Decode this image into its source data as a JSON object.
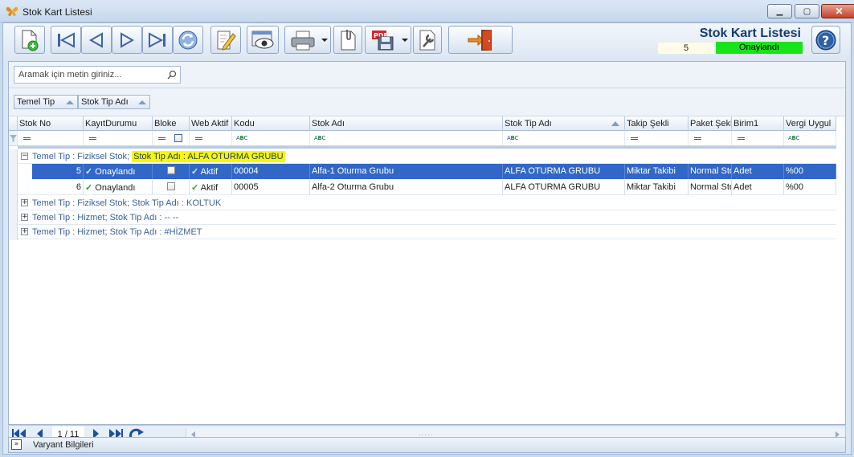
{
  "window": {
    "title": "Stok Kart Listesi"
  },
  "header": {
    "title": "Stok Kart Listesi",
    "count": "5",
    "status": "Onaylandı"
  },
  "search": {
    "placeholder": "Aramak için metin giriniz..."
  },
  "group_by": [
    "Temel Tip",
    "Stok Tip Adı"
  ],
  "columns": [
    "Stok No",
    "KayıtDurumu",
    "Bloke",
    "Web Aktif",
    "Kodu",
    "Stok Adı",
    "Stok Tip Adı",
    "Takip Şekli",
    "Paket Şekli",
    "Birim1",
    "Vergi Uygul"
  ],
  "groups": [
    {
      "expander": "−",
      "label": "Temel Tip : Fiziksel Stok;",
      "label2": "Stok Tip Adı : ALFA OTURMA GRUBU"
    },
    {
      "expander": "+",
      "label": "Temel Tip : Fiziksel Stok;",
      "label2": "Stok Tip Adı : KOLTUK"
    },
    {
      "expander": "+",
      "label": "Temel Tip : Hizmet;",
      "label2": "Stok Tip Adı : -- --"
    },
    {
      "expander": "+",
      "label": "Temel Tip : Hizmet;",
      "label2": "Stok Tip Adı : #HİZMET"
    }
  ],
  "rows": [
    {
      "no": "5",
      "durum": "Onaylandı",
      "web": "Aktif",
      "kodu": "00004",
      "adi": "Alfa-1 Oturma Grubu",
      "tip": "ALFA OTURMA GRUBU",
      "takip": "Miktar Takibi",
      "paket": "Normal Stok",
      "birim": "Adet",
      "vergi": "%00"
    },
    {
      "no": "6",
      "durum": "Onaylandı",
      "web": "Aktif",
      "kodu": "00005",
      "adi": "Alfa-2 Oturma Grubu",
      "tip": "ALFA OTURMA GRUBU",
      "takip": "Miktar Takibi",
      "paket": "Normal Stok",
      "birim": "Adet",
      "vergi": "%00"
    }
  ],
  "pager": {
    "info": "1 / 11"
  },
  "footer": {
    "variant_label": "Varyant Bilgileri"
  },
  "colors": {
    "accent": "#3167c6",
    "status_green": "#19e319",
    "highlight": "#f7f70a"
  }
}
